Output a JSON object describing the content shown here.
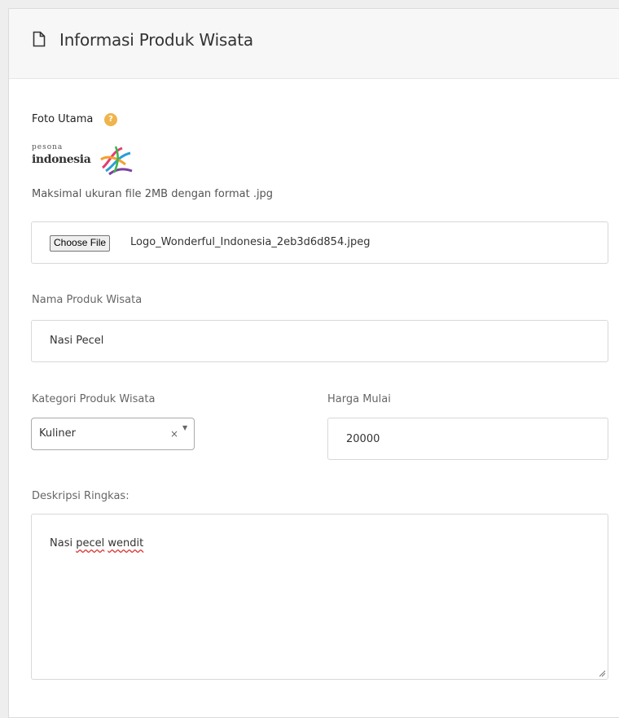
{
  "panel": {
    "title": "Informasi Produk Wisata",
    "icon": "document-icon"
  },
  "foto_utama": {
    "label": "Foto Utama",
    "help_icon": "question-icon",
    "logo_top": "pesona",
    "logo_bottom": "indonesia",
    "help_text": "Maksimal ukuran file 2MB dengan format .jpg",
    "file_button": "Choose File",
    "file_name": "Logo_Wonderful_Indonesia_2eb3d6d854.jpeg"
  },
  "nama": {
    "label": "Nama Produk Wisata",
    "value": "Nasi Pecel"
  },
  "kategori": {
    "label": "Kategori Produk Wisata",
    "selected": "Kuliner",
    "clear": "×",
    "arrow": "▼"
  },
  "harga": {
    "label": "Harga Mulai",
    "value": "20000"
  },
  "deskripsi": {
    "label": "Deskripsi Ringkas:",
    "value_plain": "Nasi ",
    "value_misspelled_1": "pecel",
    "value_space": " ",
    "value_misspelled_2": "wendit"
  },
  "colors": {
    "help_icon": "#f0b44c",
    "panel_header_bg": "#f7f7f7",
    "border": "#d8d8d8"
  }
}
